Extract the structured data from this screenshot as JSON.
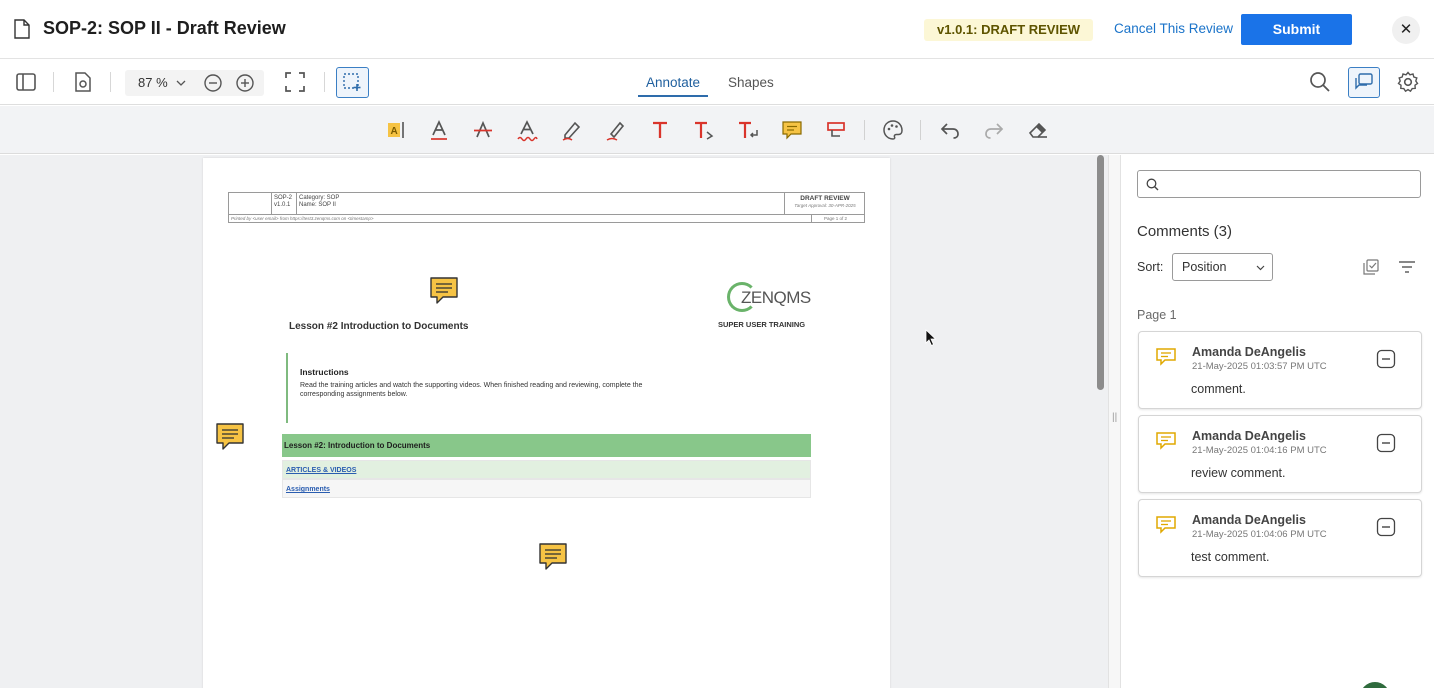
{
  "header": {
    "title": "SOP-2: SOP II - Draft Review",
    "status_badge": "v1.0.1: DRAFT REVIEW",
    "cancel_label": "Cancel This Review",
    "submit_label": "Submit",
    "close_label": "✕"
  },
  "toolbar": {
    "zoom_value": "87 %",
    "tabs": [
      {
        "label": "Annotate",
        "active": true
      },
      {
        "label": "Shapes",
        "active": false
      }
    ]
  },
  "document": {
    "header_table": {
      "doc_id": "SOP-2",
      "version": "v1.0.1",
      "category": "Category: SOP",
      "name": "Name: SOP II",
      "status": "DRAFT REVIEW",
      "target": "Target Approval: 30-APR-2025",
      "printed_by": "Printed by <user email> from https://test3.zenqms.com on <timestamp>",
      "page": "Page 1 of 2"
    },
    "lesson_title": "Lesson #2 Introduction to Documents",
    "logo_text": "ZENQMS",
    "logo_sub": "SUPER USER TRAINING",
    "instructions_title": "Instructions",
    "instructions_text": "Read the training articles and watch the supporting videos. When finished reading and reviewing, complete the corresponding assignments below.",
    "table_head": "Lesson #2: Introduction to Documents",
    "table_rows": [
      "ARTICLES & VIDEOS",
      "Assignments"
    ]
  },
  "panel": {
    "search_placeholder": "",
    "comments_heading": "Comments (3)",
    "sort_label": "Sort:",
    "sort_value": "Position",
    "page_label": "Page 1",
    "comments": [
      {
        "author": "Amanda DeAngelis",
        "time": "21-May-2025 01:03:57 PM UTC",
        "text": "comment."
      },
      {
        "author": "Amanda DeAngelis",
        "time": "21-May-2025 01:04:16 PM UTC",
        "text": "review comment."
      },
      {
        "author": "Amanda DeAngelis",
        "time": "21-May-2025 01:04:06 PM UTC",
        "text": "test comment."
      }
    ]
  },
  "colors": {
    "accent": "#1a73e8",
    "note": "#f6c344",
    "badge_bg": "#fcf7d6",
    "table_green": "#88c78a",
    "tool_red": "#d9342b"
  }
}
